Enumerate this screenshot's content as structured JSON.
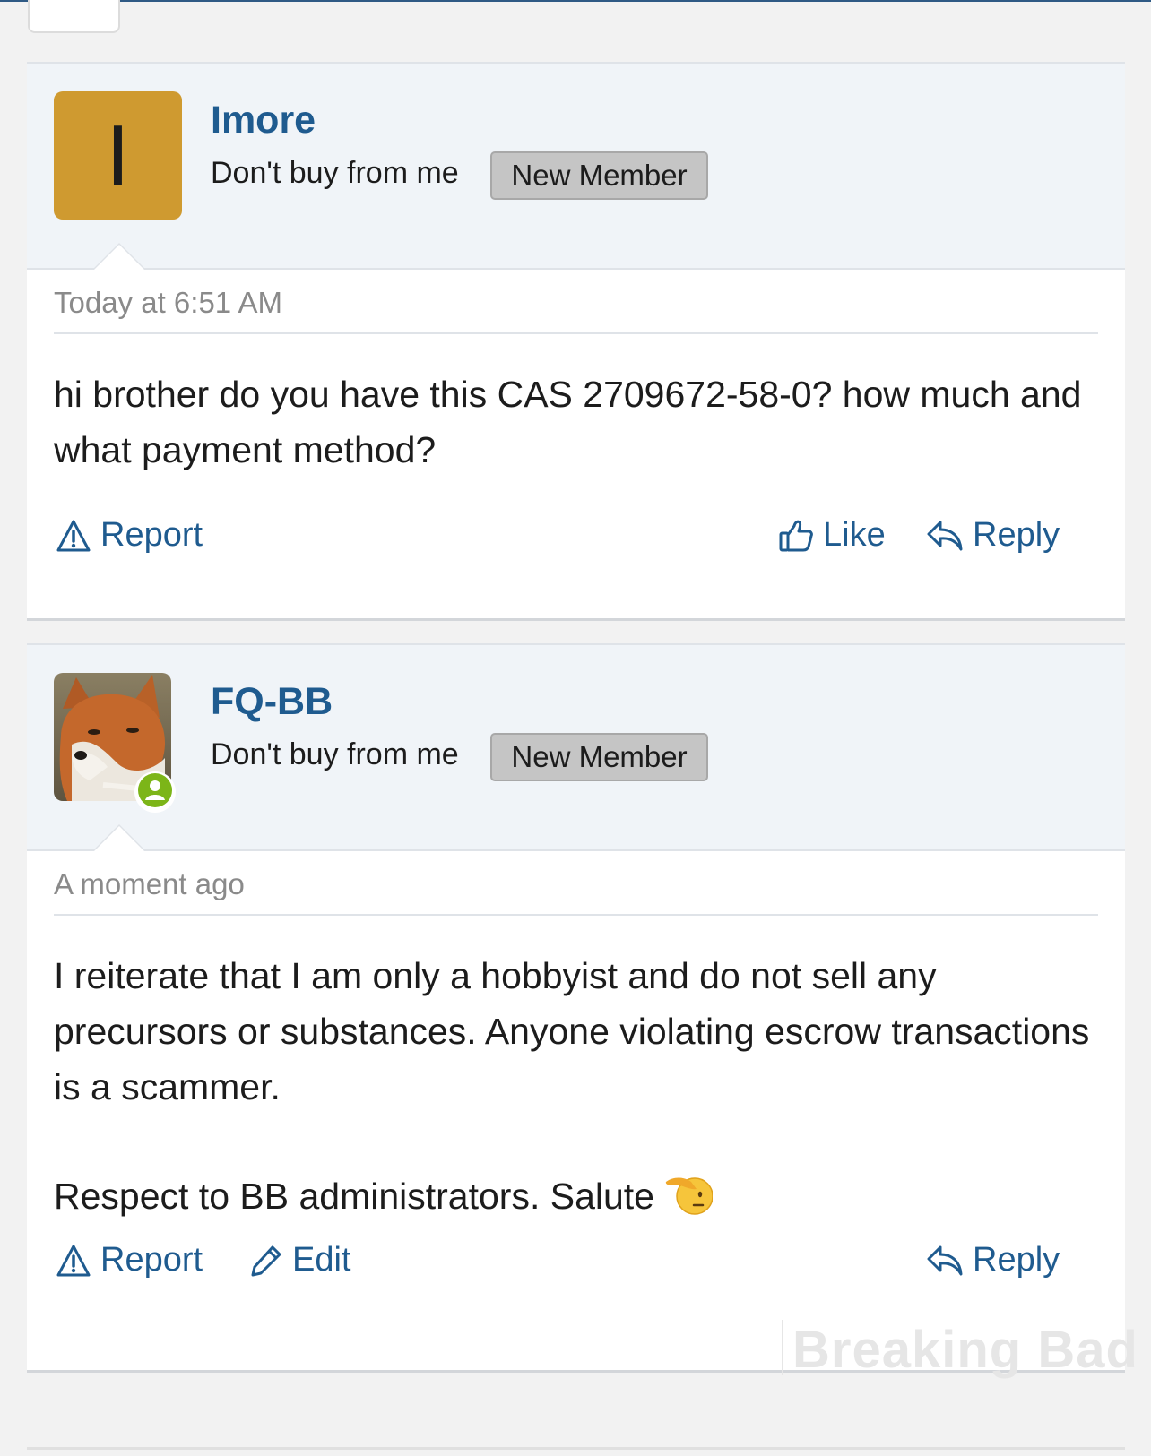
{
  "posts": [
    {
      "avatar_letter": "I",
      "username": "Imore",
      "tagline": "Don't buy from me",
      "badge": "New Member",
      "timestamp": "Today at 6:51 AM",
      "body": [
        "hi brother do you have this CAS 2709672-58-0? how much and what payment method?"
      ],
      "actions": {
        "report": "Report",
        "like": "Like",
        "reply": "Reply"
      }
    },
    {
      "username": "FQ-BB",
      "tagline": "Don't buy from me",
      "badge": "New Member",
      "timestamp": "A moment ago",
      "body": [
        "I reiterate that I am only a hobbyist and do not sell any precursors or substances. Anyone violating escrow transactions is a scammer.",
        "Respect to BB administrators. Salute"
      ],
      "actions": {
        "report": "Report",
        "edit": "Edit",
        "reply": "Reply"
      }
    }
  ],
  "watermark": "Breaking Bad",
  "colors": {
    "link": "#1f5b8f",
    "avatar_bg": "#cf9a30",
    "online": "#7cb518"
  },
  "icons": [
    "warning-icon",
    "thumbs-up-icon",
    "reply-icon",
    "pencil-icon",
    "user-icon",
    "saluting-face-emoji"
  ]
}
